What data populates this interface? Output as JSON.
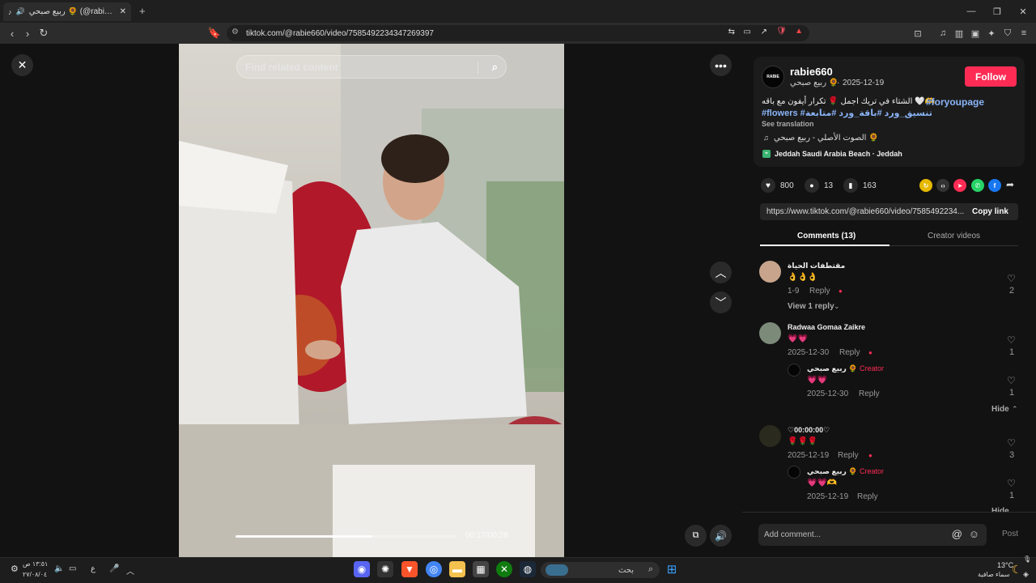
{
  "browser": {
    "tab_title": "ربيع صبحي 🌻 (@rabie660) |",
    "url": "tiktok.com/@rabie660/video/7585492234347269397",
    "new_tab_label": "+",
    "close_tab": "✕"
  },
  "video": {
    "search_placeholder": "Find related content",
    "time": "00:17/00:28",
    "progress": 0.62
  },
  "post": {
    "username": "rabie660",
    "display_name": "ربيع صبحي 🌻",
    "date": "2025-12-19",
    "avatar_text": "RABIE",
    "follow_label": "Follow",
    "caption_line1": "الشتاء في تريك اجمل 🌹 تكرار أيفون مع باقه 🤍🫶",
    "caption_tag1": "#foryoupage",
    "caption_line2_tags": "#flowers #تنسيق_ورد #باقة_ورد #متابعة",
    "see_translation": "See translation",
    "sound": "الصوت الأصلي - ربيع صبحي 🌻",
    "location": "Jeddah Saudi Arabia Beach · Jeddah",
    "likes": "800",
    "comments_count": "13",
    "saves": "163",
    "link": "https://www.tiktok.com/@rabie660/video/7585492234...",
    "copy_link": "Copy link"
  },
  "tabs": {
    "comments": "Comments (13)",
    "creator_videos": "Creator videos"
  },
  "comments": [
    {
      "name": "مقتطفات الحياة",
      "text": "👌👌👌",
      "date": "1-9",
      "reply": "Reply",
      "likes": "2",
      "view_replies": "View 1 reply"
    },
    {
      "name": "Radwaa Gomaa Zaikre",
      "text": "💗💗",
      "date": "2025-12-30",
      "reply": "Reply",
      "likes": "1",
      "sub": {
        "name": "ربيع صبحي 🌻",
        "creator": "Creator",
        "text": "💗💗",
        "date": "2025-12-30",
        "reply": "Reply",
        "likes": "1"
      },
      "hide": "Hide"
    },
    {
      "name": "♡00:00:00♡",
      "text": "🌹🌹🌹",
      "date": "2025-12-19",
      "reply": "Reply",
      "likes": "3",
      "sub": {
        "name": "ربيع صبحي 🌻",
        "creator": "Creator",
        "text": "💗💗🫶",
        "date": "2025-12-19",
        "reply": "Reply",
        "likes": "1"
      },
      "hide": "Hide"
    }
  ],
  "comment_input": {
    "placeholder": "Add comment...",
    "post": "Post"
  },
  "taskbar": {
    "clock_time": "١٣:٥١ ص",
    "clock_date": "٢٧/٠٨/٠٤",
    "search_label": "بحث",
    "weather_temp": "13°C",
    "weather_desc": "سماء صافية",
    "lang": "ع"
  }
}
